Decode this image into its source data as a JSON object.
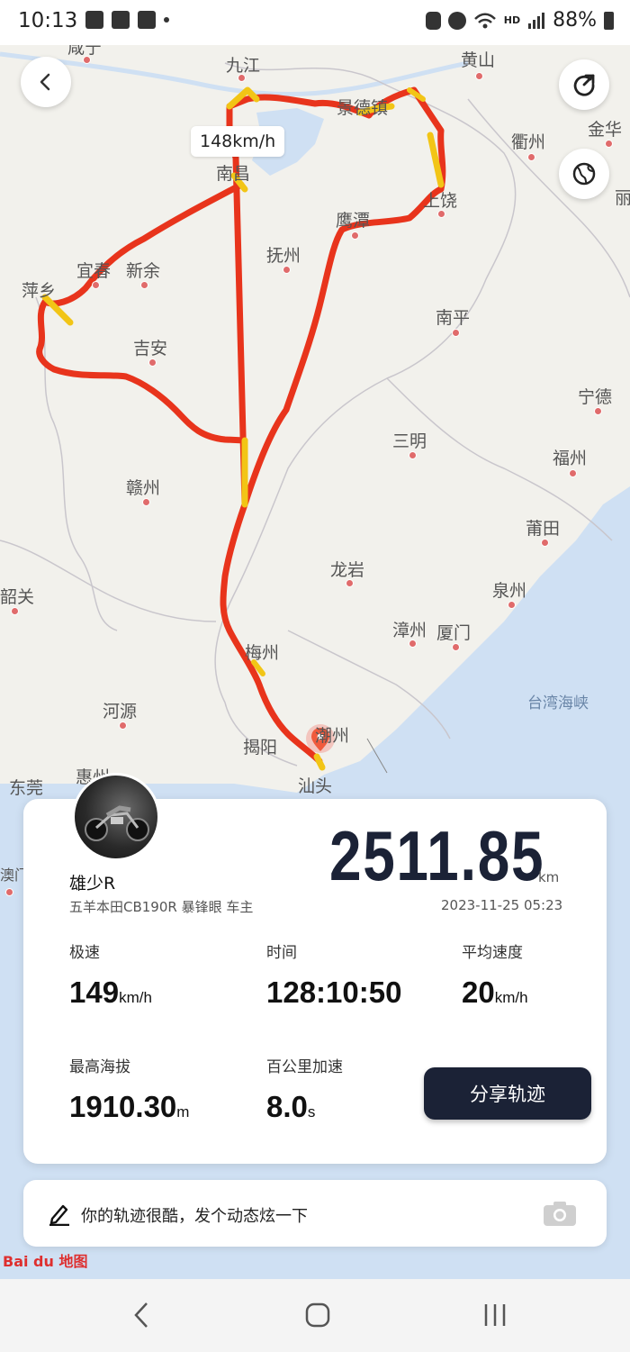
{
  "status_bar": {
    "time": "10:13",
    "battery": "88%",
    "hd_label": "HD"
  },
  "map": {
    "speed_tooltip": "148km/h",
    "cities": [
      {
        "name": "咸宁"
      },
      {
        "name": "九江"
      },
      {
        "name": "黄山"
      },
      {
        "name": "景德镇"
      },
      {
        "name": "衢州"
      },
      {
        "name": "金华"
      },
      {
        "name": "南昌"
      },
      {
        "name": "丽"
      },
      {
        "name": "鹰潭"
      },
      {
        "name": "上饶"
      },
      {
        "name": "抚州"
      },
      {
        "name": "宜春"
      },
      {
        "name": "新余"
      },
      {
        "name": "萍乡"
      },
      {
        "name": "南平"
      },
      {
        "name": "吉安"
      },
      {
        "name": "宁德"
      },
      {
        "name": "三明"
      },
      {
        "name": "福州"
      },
      {
        "name": "赣州"
      },
      {
        "name": "莆田"
      },
      {
        "name": "龙岩"
      },
      {
        "name": "韶关"
      },
      {
        "name": "泉州"
      },
      {
        "name": "漳州"
      },
      {
        "name": "厦门"
      },
      {
        "name": "梅州"
      },
      {
        "name": "河源"
      },
      {
        "name": "台湾海峡"
      },
      {
        "name": "潮州"
      },
      {
        "name": "揭阳"
      },
      {
        "name": "东莞"
      },
      {
        "name": "惠州"
      },
      {
        "name": "汕头"
      },
      {
        "name": "澳门"
      }
    ],
    "colors": {
      "track_red": "#e8341c",
      "track_yellow": "#f2c516",
      "sea": "#cfe0f3"
    }
  },
  "buttons": {
    "back_icon": "chevron-left-icon",
    "share_icon": "share-arrow-icon",
    "globe_icon": "globe-icon"
  },
  "summary": {
    "user_name": "雄少R",
    "user_sub": "五羊本田CB190R 暴锋眼 车主",
    "distance": "2511.85",
    "distance_unit": "km",
    "datetime": "2023-11-25 05:23",
    "stats": [
      {
        "label": "极速",
        "value": "149",
        "unit": "km/h"
      },
      {
        "label": "时间",
        "value": "128:10:50",
        "unit": ""
      },
      {
        "label": "平均速度",
        "value": "20",
        "unit": "km/h"
      },
      {
        "label": "最高海拔",
        "value": "1910.30",
        "unit": "m"
      },
      {
        "label": "百公里加速",
        "value": "8.0",
        "unit": "s"
      }
    ],
    "share_button": "分享轨迹"
  },
  "post_bar": {
    "text": "你的轨迹很酷，发个动态炫一下"
  },
  "baidu_logo": {
    "text": "Bai du 地图"
  },
  "brand_colors": {
    "navy": "#1b2236"
  }
}
